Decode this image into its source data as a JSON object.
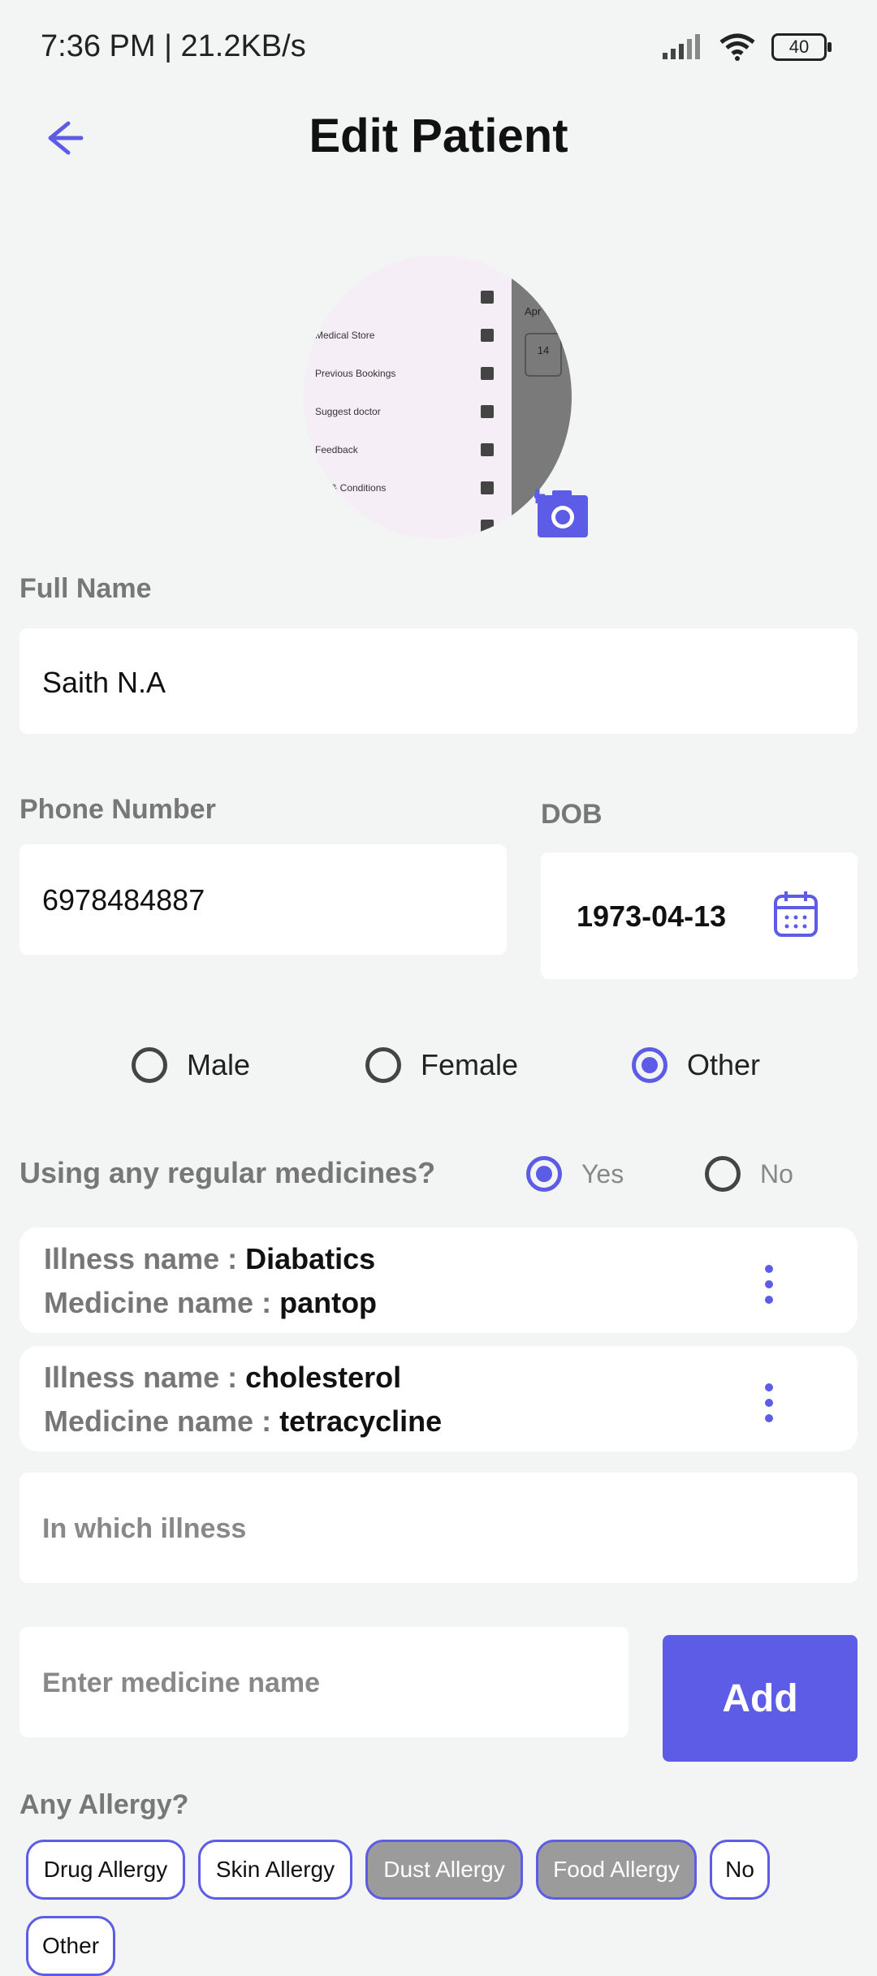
{
  "status_bar": {
    "time": "7:36 PM | 21.2KB/s",
    "battery": "40"
  },
  "header": {
    "title": "Edit Patient"
  },
  "avatar": {
    "preview_menu": [
      "Medical Store",
      "Previous Bookings",
      "Suggest doctor",
      "Feedback",
      "ms & Conditions"
    ],
    "preview_side": [
      "Apr",
      "14"
    ]
  },
  "form": {
    "full_name_label": "Full Name",
    "full_name_value": "Saith N.A",
    "phone_label": "Phone Number",
    "phone_value": "6978484887",
    "dob_label": "DOB",
    "dob_value": "1973-04-13"
  },
  "gender": {
    "options": [
      "Male",
      "Female",
      "Other"
    ],
    "selected": "Other"
  },
  "regular_medicines": {
    "question": "Using any regular medicines?",
    "options": [
      "Yes",
      "No"
    ],
    "selected": "Yes",
    "illness_key": "Illness name : ",
    "medicine_key": "Medicine name : ",
    "entries": [
      {
        "illness": "Diabatics",
        "medicine": "pantop"
      },
      {
        "illness": "cholesterol",
        "medicine": "tetracycline"
      }
    ],
    "illness_placeholder": "In which illness",
    "medicine_placeholder": "Enter medicine name",
    "add_label": "Add"
  },
  "allergy": {
    "question": "Any Allergy?",
    "chips": [
      "Drug Allergy",
      "Skin Allergy",
      "Dust Allergy",
      "Food Allergy",
      "No",
      "Other"
    ],
    "selected": [
      "Dust Allergy",
      "Food Allergy"
    ]
  },
  "colors": {
    "accent": "#5c5ce6",
    "background": "#f2f5f4",
    "chip_selected": "#9b9b9b"
  }
}
